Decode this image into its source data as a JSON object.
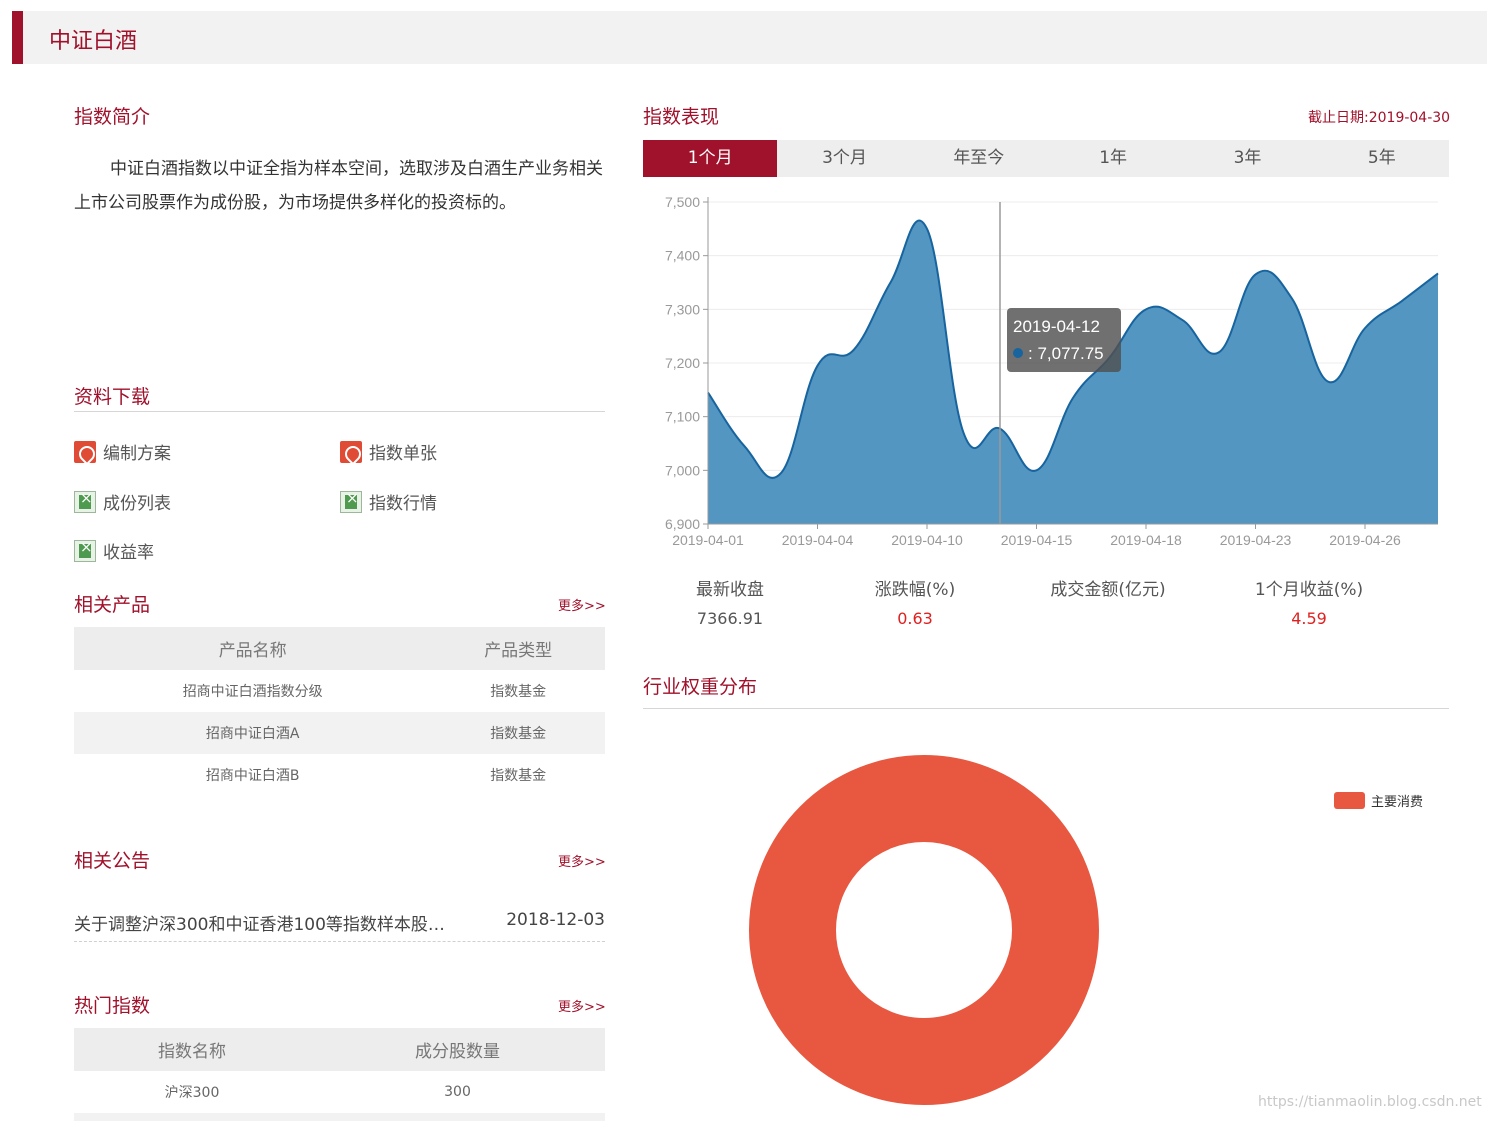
{
  "header": {
    "title": "中证白酒"
  },
  "intro": {
    "title": "指数简介",
    "text": "中证白酒指数以中证全指为样本空间，选取涉及白酒生产业务相关上市公司股票作为成份股，为市场提供多样化的投资标的。"
  },
  "downloads": {
    "title": "资料下载",
    "items": [
      {
        "label": "编制方案",
        "icon": "pdf-icon"
      },
      {
        "label": "指数单张",
        "icon": "pdf-icon"
      },
      {
        "label": "成份列表",
        "icon": "excel-icon"
      },
      {
        "label": "指数行情",
        "icon": "excel-icon"
      },
      {
        "label": "收益率",
        "icon": "excel-icon"
      }
    ]
  },
  "related_products": {
    "title": "相关产品",
    "more": "更多>>",
    "headers": [
      "产品名称",
      "产品类型"
    ],
    "rows": [
      [
        "招商中证白酒指数分级",
        "指数基金"
      ],
      [
        "招商中证白酒A",
        "指数基金"
      ],
      [
        "招商中证白酒B",
        "指数基金"
      ]
    ]
  },
  "notices": {
    "title": "相关公告",
    "more": "更多>>",
    "items": [
      {
        "text": "关于调整沪深300和中证香港100等指数样本股…",
        "date": "2018-12-03"
      }
    ]
  },
  "hot_indexes": {
    "title": "热门指数",
    "more": "更多>>",
    "headers": [
      "指数名称",
      "成分股数量"
    ],
    "rows": [
      [
        "沪深300",
        "300"
      ]
    ]
  },
  "performance": {
    "title": "指数表现",
    "as_of_label": "截止日期:",
    "as_of_date": "2019-04-30",
    "tabs": [
      "1个月",
      "3个月",
      "年至今",
      "1年",
      "3年",
      "5年"
    ],
    "active_tab": 0
  },
  "tooltip": {
    "date": "2019-04-12",
    "value": ": 7,077.75"
  },
  "stats": [
    {
      "label": "最新收盘",
      "value": "7366.91",
      "highlight": false
    },
    {
      "label": "涨跌幅(%)",
      "value": "0.63",
      "highlight": true
    },
    {
      "label": "成交金额(亿元)",
      "value": "",
      "highlight": false
    },
    {
      "label": "1个月收益(%)",
      "value": "4.59",
      "highlight": true
    }
  ],
  "industry": {
    "title": "行业权重分布",
    "legend": "主要消费"
  },
  "watermark": "https://tianmaolin.blog.csdn.net",
  "colors": {
    "brand": "#a0112b",
    "series": "#4a90bf",
    "series_line": "#17649e",
    "donut": "#e8573f",
    "up": "#e02020"
  },
  "chart_data": [
    {
      "type": "area",
      "x": [
        "2019-04-01",
        "2019-04-02",
        "2019-04-03",
        "2019-04-04",
        "2019-04-08",
        "2019-04-09",
        "2019-04-10",
        "2019-04-11",
        "2019-04-12",
        "2019-04-15",
        "2019-04-16",
        "2019-04-17",
        "2019-04-18",
        "2019-04-19",
        "2019-04-22",
        "2019-04-23",
        "2019-04-24",
        "2019-04-25",
        "2019-04-26",
        "2019-04-29",
        "2019-04-30"
      ],
      "series": [
        {
          "values": [
            7145,
            7045,
            6995,
            7195,
            7225,
            7350,
            7450,
            7070,
            7077.75,
            7000,
            7135,
            7210,
            7300,
            7280,
            7220,
            7365,
            7320,
            7165,
            7265,
            7315,
            7366.91
          ]
        }
      ],
      "x_ticks": [
        "2019-04-01",
        "2019-04-04",
        "2019-04-10",
        "2019-04-15",
        "2019-04-18",
        "2019-04-23",
        "2019-04-26"
      ],
      "y_ticks": [
        "6,900",
        "7,000",
        "7,100",
        "7,200",
        "7,300",
        "7,400",
        "7,500"
      ],
      "ylim": [
        6900,
        7500
      ],
      "grid": true
    },
    {
      "type": "pie",
      "labels": [
        "主要消费"
      ],
      "values": [
        100
      ]
    }
  ]
}
